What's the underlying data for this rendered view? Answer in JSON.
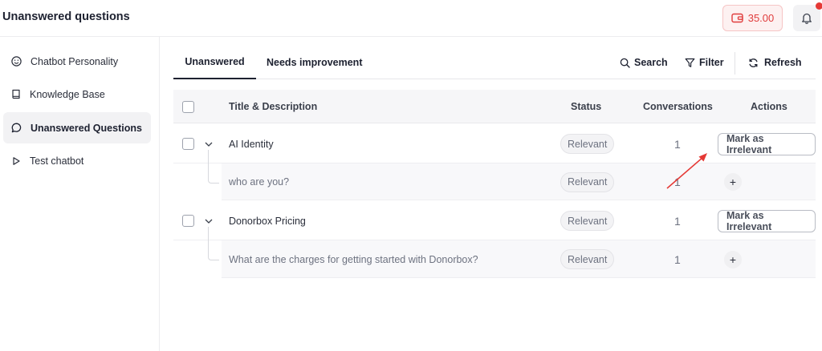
{
  "header": {
    "title": "Unanswered questions",
    "credits": "35.00",
    "colors": {
      "credits_text": "#e03c3c",
      "credits_bg": "#fdf1f1",
      "notification_dot": "#e53935"
    }
  },
  "sidebar": {
    "items": [
      {
        "label": "Chatbot Personality",
        "icon": "smile-icon",
        "active": false
      },
      {
        "label": "Knowledge Base",
        "icon": "book-icon",
        "active": false
      },
      {
        "label": "Unanswered Questions",
        "icon": "chat-bubble-icon",
        "active": true
      },
      {
        "label": "Test chatbot",
        "icon": "play-icon",
        "active": false
      }
    ]
  },
  "tabs": [
    {
      "label": "Unanswered",
      "active": true
    },
    {
      "label": "Needs improvement",
      "active": false
    }
  ],
  "toolbar": {
    "search": "Search",
    "filter": "Filter",
    "refresh": "Refresh"
  },
  "table": {
    "columns": [
      "Title & Description",
      "Status",
      "Conversations",
      "Actions"
    ],
    "rows": [
      {
        "title": "AI Identity",
        "status": "Relevant",
        "conversations": "1",
        "action": "Mark as Irrelevant",
        "child": {
          "text": "who are you?",
          "status": "Relevant",
          "conversations": "1",
          "action": "+"
        }
      },
      {
        "title": "Donorbox Pricing",
        "status": "Relevant",
        "conversations": "1",
        "action": "Mark as Irrelevant",
        "child": {
          "text": "What are the charges for getting started with Donorbox?",
          "status": "Relevant",
          "conversations": "1",
          "action": "+"
        }
      }
    ]
  },
  "annotation": {
    "color": "#e53935"
  }
}
